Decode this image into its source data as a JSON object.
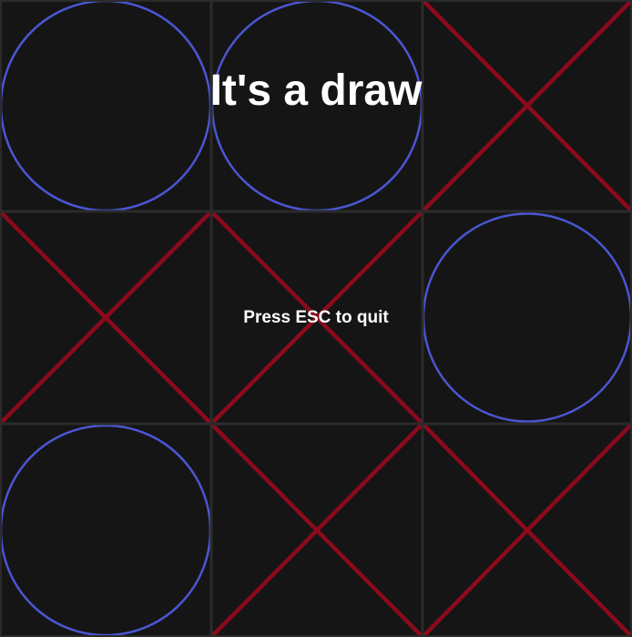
{
  "game": {
    "result_text": "It's a draw",
    "hint_text": "Press ESC to quit",
    "board": [
      [
        "O",
        "O",
        "X"
      ],
      [
        "X",
        "X",
        "O"
      ],
      [
        "O",
        "X",
        "X"
      ]
    ],
    "colors": {
      "background": "#151515",
      "grid": "#2b2b2b",
      "o_mark": "#4a56d2",
      "x_mark": "#8b0a1c",
      "text": "#ffffff"
    }
  }
}
